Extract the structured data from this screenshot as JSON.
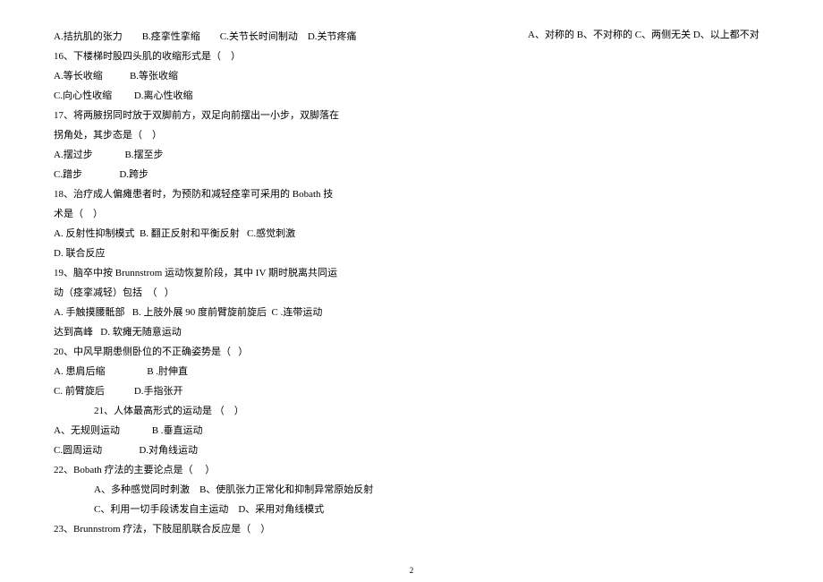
{
  "lines": [
    {
      "text": "A.拮抗肌的张力        B.痉挛性挛缩        C.关节长时间制动    D.关节疼痛",
      "indent": 0
    },
    {
      "text": "16、下楼梯时股四头肌的收缩形式是（    ）",
      "indent": 0
    },
    {
      "text": "A.等长收缩           B.等张收缩",
      "indent": 0
    },
    {
      "text": "C.向心性收缩         D.离心性收缩",
      "indent": 0
    },
    {
      "text": "17、将两腋拐同时放于双脚前方，双足向前摆出一小步，双脚落在",
      "indent": 0
    },
    {
      "text": "拐角处，其步态是（    ）",
      "indent": 0
    },
    {
      "text": "A.摆过步             B.摆至步",
      "indent": 0
    },
    {
      "text": "C.蹭步               D.跨步",
      "indent": 0
    },
    {
      "text": "18、治疗成人偏瘫患者时，为预防和减轻痉挛可采用的 Bobath 技",
      "indent": 0
    },
    {
      "text": "术是（    ）",
      "indent": 0
    },
    {
      "text": "A. 反射性抑制模式  B. 翻正反射和平衡反射   C.感觉刺激",
      "indent": 0
    },
    {
      "text": "D. 联合反应",
      "indent": 0
    },
    {
      "text": "19、脑卒中按 Brunnstrom 运动恢复阶段，其中 IV 期时脱离共同运",
      "indent": 0
    },
    {
      "text": "动（痉挛减轻）包括  （   ）",
      "indent": 0
    },
    {
      "text": "A. 手触摸腰骶部   B. 上肢外展 90 度前臂旋前旋后  C .连带运动",
      "indent": 0
    },
    {
      "text": "达到高峰   D. 软瘫无随意运动",
      "indent": 0
    },
    {
      "text": "20、中风早期患侧卧位的不正确姿势是（   ）",
      "indent": 0
    },
    {
      "text": "A. 患肩后缩                 B .肘伸直",
      "indent": 0
    },
    {
      "text": "C. 前臂旋后            D.手指张开",
      "indent": 0
    },
    {
      "text": "21、人体最高形式的运动是 （    ）",
      "indent": 1
    },
    {
      "text": "A、无规则运动             B .垂直运动",
      "indent": 0
    },
    {
      "text": "C.圆周运动               D.对角线运动",
      "indent": 0
    },
    {
      "text": "22、Bobath 疗法的主要论点是（     ）",
      "indent": 0
    },
    {
      "text": "A、多种感觉同时刺激    B、使肌张力正常化和抑制异常原始反射",
      "indent": 1
    },
    {
      "text": "C、利用一切手段诱发自主运动    D、采用对角线模式",
      "indent": 1
    },
    {
      "text": "23、Brunnstrom 疗法，下肢屈肌联合反应是（    ）",
      "indent": 0
    }
  ],
  "right_column_text": "A、对称的 B、不对称的 C、两侧无关 D、以上都不对",
  "page_number": "2"
}
